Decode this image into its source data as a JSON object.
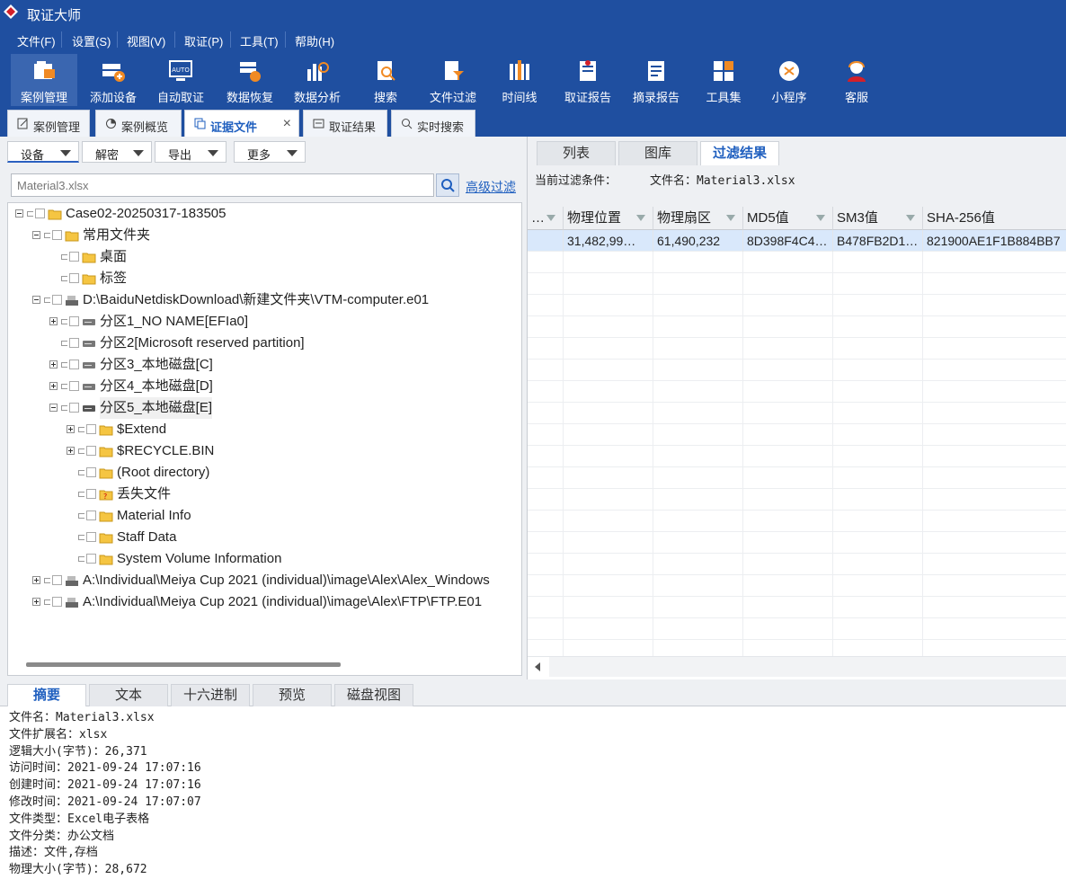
{
  "app": {
    "title": "取证大师"
  },
  "menu": [
    "文件(F)",
    "设置(S)",
    "视图(V)",
    "取证(P)",
    "工具(T)",
    "帮助(H)"
  ],
  "toolbar": [
    {
      "label": "案例管理",
      "icon": "case-management-icon"
    },
    {
      "label": "添加设备",
      "icon": "add-device-icon"
    },
    {
      "label": "自动取证",
      "icon": "auto-forensics-icon"
    },
    {
      "label": "数据恢复",
      "icon": "data-recovery-icon"
    },
    {
      "label": "数据分析",
      "icon": "data-analysis-icon"
    },
    {
      "label": "搜索",
      "icon": "search-icon"
    },
    {
      "label": "文件过滤",
      "icon": "file-filter-icon"
    },
    {
      "label": "时间线",
      "icon": "timeline-icon"
    },
    {
      "label": "取证报告",
      "icon": "forensics-report-icon"
    },
    {
      "label": "摘录报告",
      "icon": "excerpt-report-icon"
    },
    {
      "label": "工具集",
      "icon": "toolset-icon"
    },
    {
      "label": "小程序",
      "icon": "mini-program-icon"
    },
    {
      "label": "客服",
      "icon": "customer-service-icon"
    }
  ],
  "doc_tabs": [
    {
      "label": "案例管理"
    },
    {
      "label": "案例概览"
    },
    {
      "label": "证据文件",
      "close": "×"
    },
    {
      "label": "取证结果"
    },
    {
      "label": "实时搜索"
    }
  ],
  "left": {
    "dropdowns": [
      "设备",
      "解密",
      "导出",
      "更多"
    ],
    "search_value": "Material3.xlsx",
    "advanced_filter": "高级过滤",
    "tree": [
      {
        "label": "Case02-20250317-183505"
      },
      {
        "label": "常用文件夹"
      },
      {
        "label": "桌面"
      },
      {
        "label": "标签"
      },
      {
        "label": "D:\\BaiduNetdiskDownload\\新建文件夹\\VTM-computer.e01"
      },
      {
        "label": "分区1_NO NAME[EFIa0]"
      },
      {
        "label": "分区2[Microsoft reserved partition]"
      },
      {
        "label": "分区3_本地磁盘[C]"
      },
      {
        "label": "分区4_本地磁盘[D]"
      },
      {
        "label": "分区5_本地磁盘[E]"
      },
      {
        "label": "$Extend"
      },
      {
        "label": "$RECYCLE.BIN"
      },
      {
        "label": "(Root directory)"
      },
      {
        "label": "丢失文件"
      },
      {
        "label": "Material Info"
      },
      {
        "label": "Staff Data"
      },
      {
        "label": "System Volume Information"
      },
      {
        "label": "A:\\Individual\\Meiya Cup 2021 (individual)\\image\\Alex\\Alex_Windows"
      },
      {
        "label": "A:\\Individual\\Meiya Cup 2021 (individual)\\image\\Alex\\FTP\\FTP.E01"
      }
    ]
  },
  "right": {
    "tabs": [
      "列表",
      "图库",
      "过滤结果"
    ],
    "filter_label": "当前过滤条件：",
    "filter_value": "文件名：Material3.xlsx",
    "columns": [
      "…",
      "物理位置",
      "物理扇区",
      "MD5值",
      "SM3值",
      "SHA-256值"
    ],
    "rows": [
      [
        "",
        "31,482,99…",
        "61,490,232",
        "8D398F4C4…",
        "B478FB2D1…",
        "821900AE1F1B884BB7"
      ]
    ]
  },
  "bottom": {
    "tabs": [
      "摘要",
      "文本",
      "十六进制",
      "预览",
      "磁盘视图"
    ],
    "properties": [
      "文件名：Material3.xlsx",
      "文件扩展名：xlsx",
      "逻辑大小(字节)：26,371",
      "访问时间：2021-09-24 17:07:16",
      "创建时间：2021-09-24 17:07:16",
      "修改时间：2021-09-24 17:07:07",
      "文件类型：Excel电子表格",
      "文件分类：办公文档",
      "描述：文件,存档",
      "物理大小(字节)：28,672"
    ]
  },
  "colors": {
    "brand_blue": "#1f4fa0",
    "accent": "#1f5fbf",
    "selected_row": "#d9e8fb"
  }
}
